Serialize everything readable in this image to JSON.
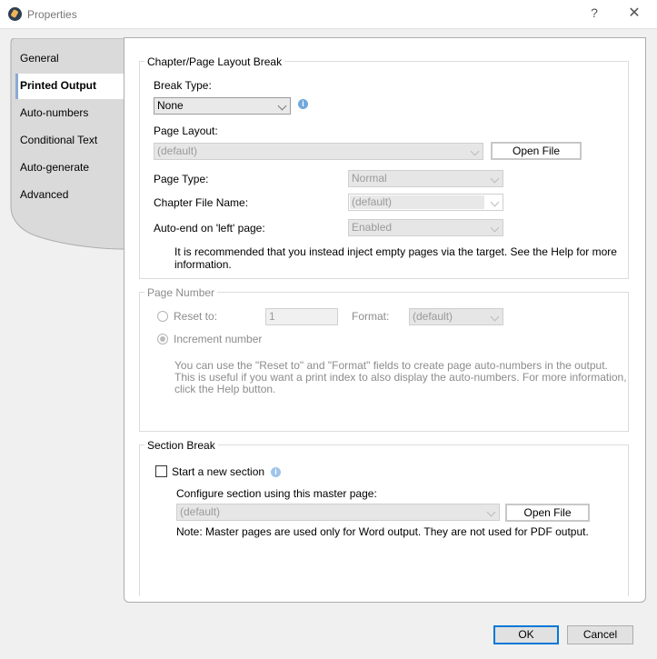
{
  "window": {
    "title": "Properties",
    "help_glyph": "?",
    "close_glyph": "✕"
  },
  "tabs": [
    {
      "label": "General"
    },
    {
      "label": "Printed Output"
    },
    {
      "label": "Auto-numbers"
    },
    {
      "label": "Conditional Text"
    },
    {
      "label": "Auto-generate"
    },
    {
      "label": "Advanced"
    }
  ],
  "chapter_break": {
    "legend": "Chapter/Page Layout Break",
    "break_type_label": "Break Type:",
    "break_type_value": "None",
    "page_layout_label": "Page Layout:",
    "page_layout_value": "(default)",
    "open_file_label": "Open File",
    "page_type_label": "Page Type:",
    "page_type_value": "Normal",
    "chapter_file_name_label": "Chapter File Name:",
    "chapter_file_name_value": "(default)",
    "auto_end_label": "Auto-end on 'left' page:",
    "auto_end_value": "Enabled",
    "note_line1": "It is recommended that you instead inject empty pages via the target.  See the Help for more",
    "note_line2": "information."
  },
  "page_number": {
    "legend": "Page Number",
    "reset_to_label": "Reset to:",
    "reset_to_value": "1",
    "format_label": "Format:",
    "format_value": "(default)",
    "increment_label": "Increment number",
    "note_line1": "You can use the \"Reset to\" and \"Format\" fields to create page auto-numbers in the output.",
    "note_line2": "This is useful if you want a print index to also display the auto-numbers. For more information,",
    "note_line3": "click the Help button."
  },
  "section_break": {
    "legend": "Section Break",
    "start_new_section_label": "Start a new section",
    "configure_label": "Configure section using this master page:",
    "master_page_value": "(default)",
    "open_file_label": "Open File",
    "note": "Note: Master pages are used only for Word output. They are not used for PDF output."
  },
  "footer": {
    "ok_label": "OK",
    "cancel_label": "Cancel"
  },
  "colors": {
    "ok_border": "#0078d7",
    "info_icon": "#6fa8dc",
    "tab_active_bar": "#8aa9d6"
  }
}
